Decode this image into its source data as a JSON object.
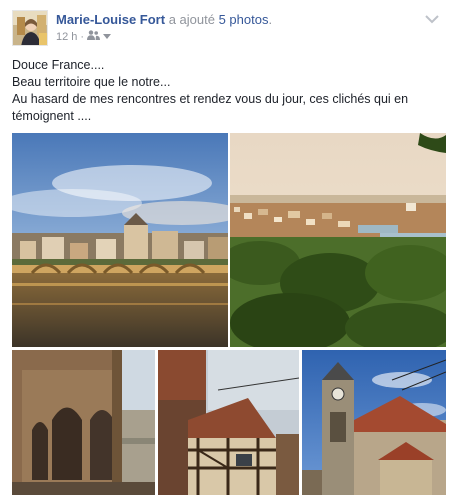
{
  "post": {
    "author": "Marie-Louise Fort",
    "action": "a ajouté",
    "photos_label": "5 photos",
    "period": ".",
    "timestamp": "12 h",
    "separator": "·",
    "text_lines": [
      "Douce France....",
      "Beau territoire que le notre...",
      "Au hasard de mes rencontres et rendez vous du jour, ces clichés qui en témoignent ...."
    ]
  },
  "icons": {
    "audience": "friends-icon",
    "dropdown": "caret-down-icon",
    "menu": "chevron-down-icon"
  },
  "colors": {
    "link": "#365899",
    "meta": "#90949c",
    "text": "#1d2129"
  }
}
